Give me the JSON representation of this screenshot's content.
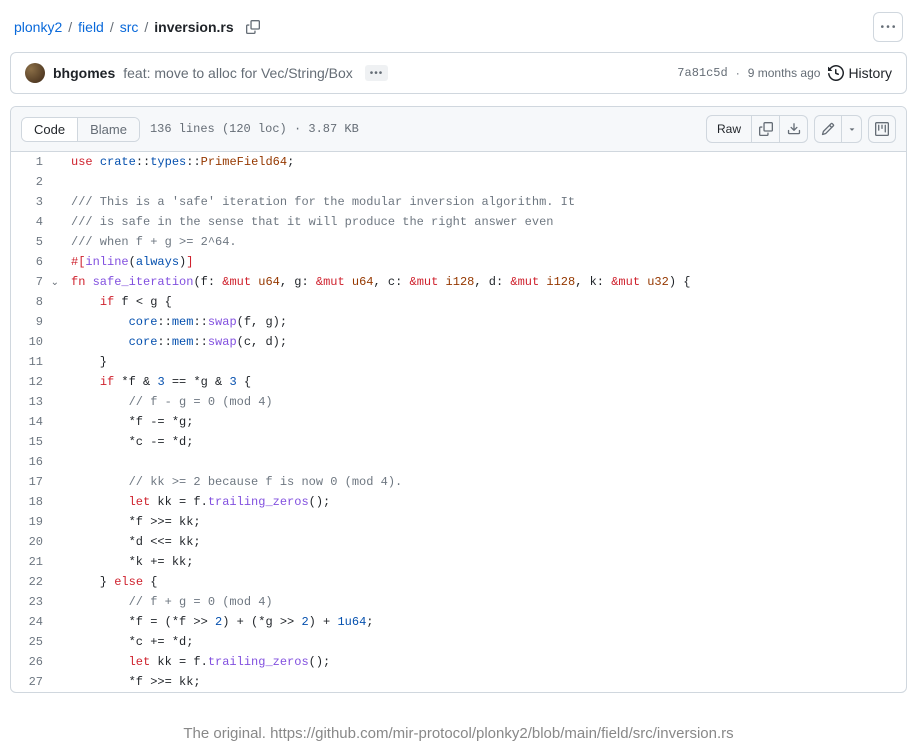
{
  "breadcrumb": {
    "parts": [
      "plonky2",
      "field",
      "src"
    ],
    "current": "inversion.rs"
  },
  "commit": {
    "author": "bhgomes",
    "message": "feat: move to alloc for Vec/String/Box",
    "sha": "7a81c5d",
    "age": "9 months ago",
    "history_label": "History"
  },
  "file_header": {
    "code_tab": "Code",
    "blame_tab": "Blame",
    "info": "136 lines (120 loc) · 3.87 KB",
    "raw_label": "Raw"
  },
  "code": [
    {
      "n": 1,
      "html": "<span class='tok-kw'>use</span> <span class='tok-id'>crate</span>::<span class='tok-id'>types</span>::<span class='tok-type'>PrimeField64</span>;"
    },
    {
      "n": 2,
      "html": ""
    },
    {
      "n": 3,
      "html": "<span class='tok-com'>/// This is a 'safe' iteration for the modular inversion algorithm. It</span>"
    },
    {
      "n": 4,
      "html": "<span class='tok-com'>/// is safe in the sense that it will produce the right answer even</span>"
    },
    {
      "n": 5,
      "html": "<span class='tok-com'>/// when f + g >= 2^64.</span>"
    },
    {
      "n": 6,
      "html": "<span class='tok-kw'>#[</span><span class='tok-fn'>inline</span>(<span class='tok-id'>always</span>)<span class='tok-kw'>]</span>"
    },
    {
      "n": 7,
      "html": "<span class='tok-kw'>fn</span> <span class='tok-fn'>safe_iteration</span>(f: <span class='tok-kw'>&mut</span> <span class='tok-type'>u64</span>, g: <span class='tok-kw'>&mut</span> <span class='tok-type'>u64</span>, c: <span class='tok-kw'>&mut</span> <span class='tok-type'>i128</span>, d: <span class='tok-kw'>&mut</span> <span class='tok-type'>i128</span>, k: <span class='tok-kw'>&mut</span> <span class='tok-type'>u32</span>) {",
      "chevron": true
    },
    {
      "n": 8,
      "html": "    <span class='tok-kw'>if</span> f &lt; g {"
    },
    {
      "n": 9,
      "html": "        <span class='tok-id'>core</span>::<span class='tok-id'>mem</span>::<span class='tok-fn'>swap</span>(f, g);"
    },
    {
      "n": 10,
      "html": "        <span class='tok-id'>core</span>::<span class='tok-id'>mem</span>::<span class='tok-fn'>swap</span>(c, d);"
    },
    {
      "n": 11,
      "html": "    }"
    },
    {
      "n": 12,
      "html": "    <span class='tok-kw'>if</span> *f &amp; <span class='tok-num'>3</span> == *g &amp; <span class='tok-num'>3</span> {"
    },
    {
      "n": 13,
      "html": "        <span class='tok-com'>// f - g = 0 (mod 4)</span>"
    },
    {
      "n": 14,
      "html": "        *f -= *g;"
    },
    {
      "n": 15,
      "html": "        *c -= *d;"
    },
    {
      "n": 16,
      "html": ""
    },
    {
      "n": 17,
      "html": "        <span class='tok-com'>// kk >= 2 because f is now 0 (mod 4).</span>"
    },
    {
      "n": 18,
      "html": "        <span class='tok-kw'>let</span> kk = f.<span class='tok-fn'>trailing_zeros</span>();"
    },
    {
      "n": 19,
      "html": "        *f &gt;&gt;= kk;"
    },
    {
      "n": 20,
      "html": "        *d &lt;&lt;= kk;"
    },
    {
      "n": 21,
      "html": "        *k += kk;"
    },
    {
      "n": 22,
      "html": "    } <span class='tok-kw'>else</span> {"
    },
    {
      "n": 23,
      "html": "        <span class='tok-com'>// f + g = 0 (mod 4)</span>"
    },
    {
      "n": 24,
      "html": "        *f = (*f &gt;&gt; <span class='tok-num'>2</span>) + (*g &gt;&gt; <span class='tok-num'>2</span>) + <span class='tok-num'>1u64</span>;"
    },
    {
      "n": 25,
      "html": "        *c += *d;"
    },
    {
      "n": 26,
      "html": "        <span class='tok-kw'>let</span> kk = f.<span class='tok-fn'>trailing_zeros</span>();"
    },
    {
      "n": 27,
      "html": "        *f &gt;&gt;= kk;"
    }
  ],
  "caption": {
    "text": "The original. ",
    "url": "https://github.com/mir-protocol/plonky2/blob/main/field/src/inversion.rs"
  }
}
